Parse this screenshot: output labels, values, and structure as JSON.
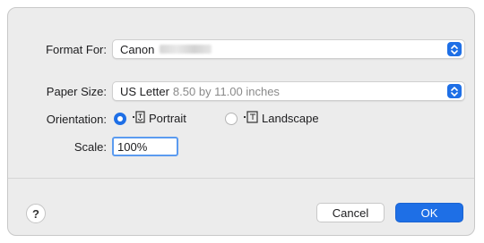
{
  "format_for": {
    "label": "Format For:",
    "value": "Canon"
  },
  "paper_size": {
    "label": "Paper Size:",
    "value": "US Letter",
    "detail": "8.50 by 11.00 inches"
  },
  "orientation": {
    "label": "Orientation:",
    "options": [
      {
        "label": "Portrait",
        "selected": true
      },
      {
        "label": "Landscape",
        "selected": false
      }
    ]
  },
  "scale": {
    "label": "Scale:",
    "value": "100%"
  },
  "footer": {
    "help_label": "?",
    "cancel_label": "Cancel",
    "ok_label": "OK"
  },
  "colors": {
    "accent": "#1e6fe6",
    "dialog_bg": "#ececec"
  }
}
